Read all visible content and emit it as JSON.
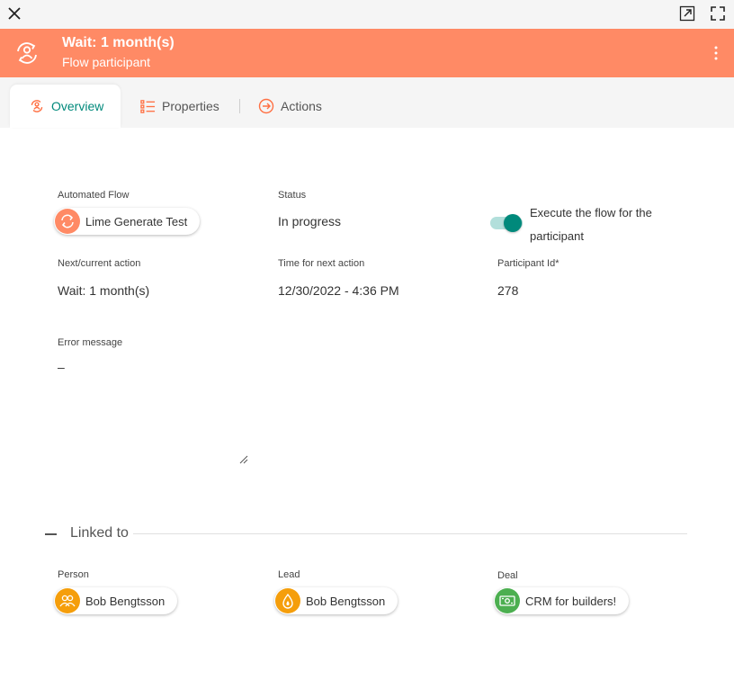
{
  "window": {
    "close_icon": "close-icon",
    "open_icon": "open-in-new-icon",
    "fullscreen_icon": "fullscreen-icon"
  },
  "header": {
    "title": "Wait: 1 month(s)",
    "subtitle": "Flow participant",
    "bg_color": "#ff8a65",
    "icon": "flow-participant-icon"
  },
  "tabs": [
    {
      "label": "Overview",
      "icon": "flow-participant-icon",
      "active": true
    },
    {
      "label": "Properties",
      "icon": "list-icon",
      "active": false
    },
    {
      "label": "Actions",
      "icon": "arrow-circle-icon",
      "active": false
    }
  ],
  "fields": {
    "automated_flow": {
      "label": "Automated Flow",
      "value": "Lime Generate Test"
    },
    "status": {
      "label": "Status",
      "value": "In progress"
    },
    "execute": {
      "label": "Execute the flow for the participant",
      "on": true
    },
    "next_action": {
      "label": "Next/current action",
      "value": "Wait: 1 month(s)"
    },
    "time_next": {
      "label": "Time for next action",
      "value": "12/30/2022 - 4:36 PM"
    },
    "participant_id": {
      "label": "Participant Id*",
      "value": "278"
    },
    "error_message": {
      "label": "Error message",
      "value": "–"
    }
  },
  "linked": {
    "title": "Linked to",
    "person": {
      "label": "Person",
      "value": "Bob Bengtsson",
      "color": "#f59e0b"
    },
    "lead": {
      "label": "Lead",
      "value": "Bob Bengtsson",
      "color": "#f59e0b"
    },
    "deal": {
      "label": "Deal",
      "value": "CRM for builders!",
      "color": "#4caf50"
    }
  },
  "colors": {
    "accent": "#00897b",
    "header": "#ff8a65",
    "frame": "#f5a623"
  }
}
